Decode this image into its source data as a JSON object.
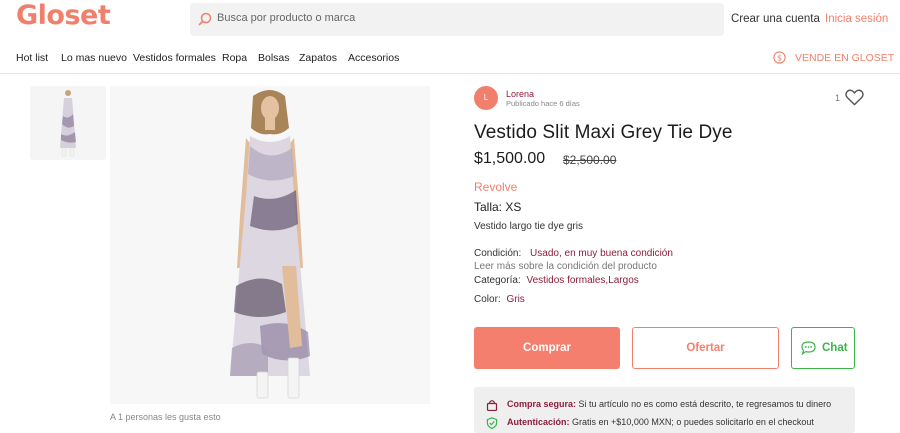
{
  "header": {
    "logo": "Gloset",
    "search_placeholder": "Busca por producto o marca",
    "create_account": "Crear una cuenta",
    "login": "Inicia sesión"
  },
  "nav": {
    "items": [
      "Hot list",
      "Lo mas nuevo",
      "Vestidos formales",
      "Ropa",
      "Bolsas",
      "Zapatos",
      "Accesorios"
    ],
    "sell": "VENDE EN GLOSET"
  },
  "gallery": {
    "likes_text": "A 1 personas les gusta esto"
  },
  "seller": {
    "initial": "L",
    "name": "Lorena",
    "posted": "Publicado hace 6 días",
    "like_count": "1"
  },
  "product": {
    "title": "Vestido Slit Maxi Grey Tie Dye",
    "price": "$1,500.00",
    "old_price": "$2,500.00",
    "brand": "Revolve",
    "size": "Talla:  XS",
    "description": "Vestido largo tie dye gris",
    "condition_label": "Condición:",
    "condition_value": "Usado, en muy buena condición",
    "condition_more": "Leer más sobre la condición del producto",
    "category_label": "Categoría:",
    "category_value": "Vestidos formales,Largos",
    "color_label": "Color:",
    "color_value": "Gris"
  },
  "actions": {
    "buy": "Comprar",
    "offer": "Ofertar",
    "chat": "Chat"
  },
  "guarantee": {
    "secure_label": "Compra segura:",
    "secure_text": "Si tu artículo no es como está descrito, te regresamos tu dinero",
    "auth_label": "Autenticación:",
    "auth_text": "Gratis en +$10,000 MXN; o puedes solicitarlo en el checkout"
  },
  "colors": {
    "brand": "#f0806c",
    "accent_dark": "#8b1e3a",
    "chat_green": "#3bb54a"
  },
  "icons": [
    "search-icon",
    "dollar-circle-icon",
    "heart-icon",
    "chat-bubble-icon",
    "bag-lock-icon",
    "shield-check-icon"
  ]
}
